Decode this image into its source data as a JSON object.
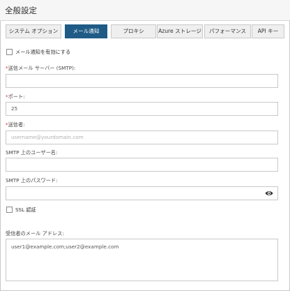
{
  "window": {
    "title": "全般設定"
  },
  "tabs": [
    {
      "label": "システム オプション"
    },
    {
      "label": "メール通知"
    },
    {
      "label": "プロキシ"
    },
    {
      "label": "Azure ストレージ"
    },
    {
      "label": "パフォーマンス"
    },
    {
      "label": "API キー"
    }
  ],
  "active_tab": "メール通知",
  "enable_email": {
    "label": "メール通知を有効にする",
    "checked": false
  },
  "smtp_server": {
    "required_mark": "*",
    "label": "送信メール サーバー (SMTP):",
    "value": ""
  },
  "port": {
    "required_mark": "*",
    "label": "ポート:",
    "value": "25"
  },
  "sender": {
    "required_mark": "*",
    "label": "送信者:",
    "value": "",
    "placeholder": "username@yourdomain.com"
  },
  "smtp_user": {
    "label": "SMTP 上のユーザー名:",
    "value": ""
  },
  "smtp_password": {
    "label": "SMTP 上のパスワード:",
    "value": ""
  },
  "ssl": {
    "label": "SSL 認証",
    "checked": false
  },
  "recipients": {
    "label": "受信者のメール アドレス:",
    "value": "user1@example.com;user2@example.com"
  },
  "colors": {
    "active_tab": "#1f5b86",
    "required": "#d9262f"
  },
  "icons": {
    "password_toggle": "eye-icon"
  }
}
